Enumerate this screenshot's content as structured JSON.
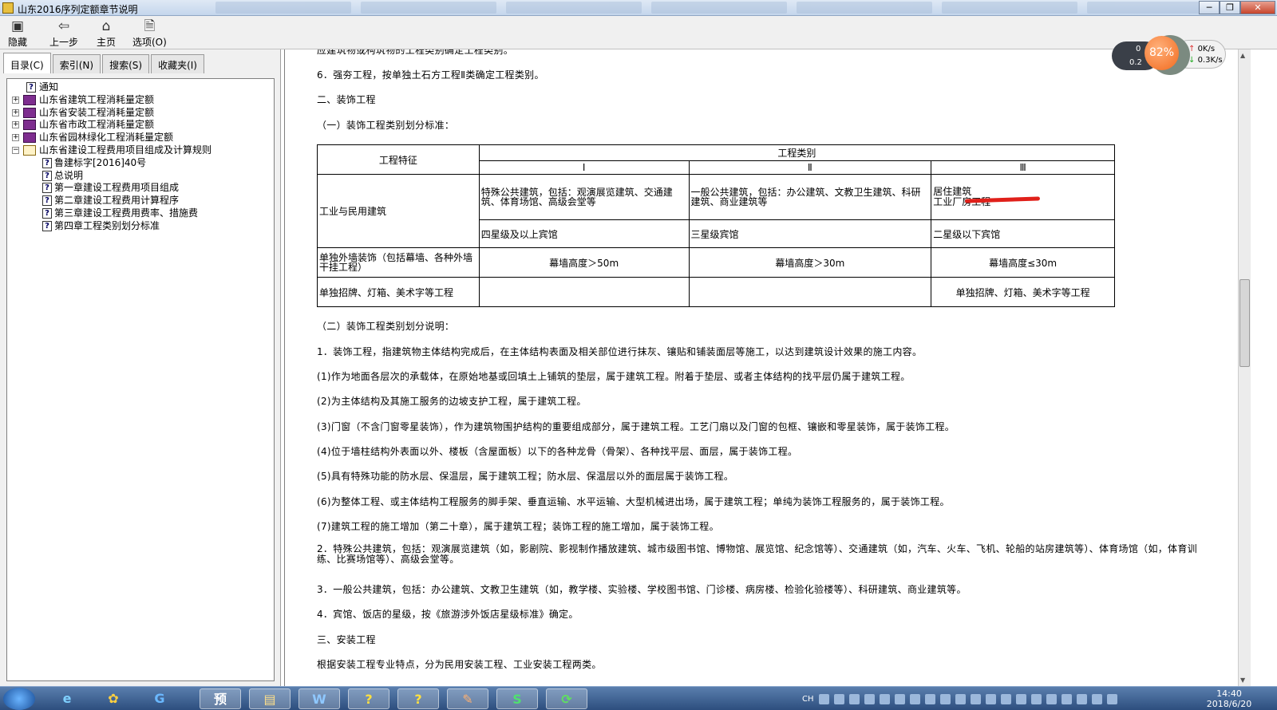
{
  "window": {
    "title": "山东2016序列定额章节说明",
    "buttons": [
      "─",
      "❐",
      "✕"
    ]
  },
  "toolbar": {
    "hide": "隐藏",
    "back": "上一步",
    "home": "主页",
    "options": "选项(O)"
  },
  "tabs": [
    "目录(C)",
    "索引(N)",
    "搜索(S)",
    "收藏夹(I)"
  ],
  "tree": [
    {
      "label": "通知",
      "type": "page",
      "level": 0
    },
    {
      "label": "山东省建筑工程消耗量定额",
      "type": "book",
      "level": 0
    },
    {
      "label": "山东省安装工程消耗量定额",
      "type": "book",
      "level": 0
    },
    {
      "label": "山东省市政工程消耗量定额",
      "type": "book",
      "level": 0
    },
    {
      "label": "山东省园林绿化工程消耗量定额",
      "type": "book",
      "level": 0
    },
    {
      "label": "山东省建设工程费用项目组成及计算规则",
      "type": "book-open",
      "level": 0
    },
    {
      "label": "鲁建标字[2016]40号",
      "type": "page",
      "level": 1
    },
    {
      "label": "总说明",
      "type": "page",
      "level": 1
    },
    {
      "label": "第一章建设工程费用项目组成",
      "type": "page",
      "level": 1
    },
    {
      "label": "第二章建设工程费用计算程序",
      "type": "page",
      "level": 1
    },
    {
      "label": "第三章建设工程费用费率、措施费",
      "type": "page",
      "level": 1
    },
    {
      "label": "第四章工程类别划分标准",
      "type": "page",
      "level": 1
    }
  ],
  "content": {
    "cut_line": "应建筑物或构筑物的工程类别确定工程类别。",
    "p_qianghang": "6．强夯工程，按单独土石方工程Ⅱ类确定工程类别。",
    "h_zhuangshi": "二、装饰工程",
    "h_sub1": "（一）装饰工程类别划分标准：",
    "table": {
      "h_feature": "工程特征",
      "h_category": "工程类别",
      "h_I": "Ⅰ",
      "h_II": "Ⅱ",
      "h_III": "Ⅲ",
      "r1_label": "工业与民用建筑",
      "r1a_I": "特殊公共建筑，包括：观演展览建筑、交通建筑、体育场馆、高级会堂等",
      "r1a_II": "一般公共建筑，包括：办公建筑、文教卫生建筑、科研建筑、商业建筑等",
      "r1a_III_1": "居住建筑",
      "r1a_III_2": "工业厂房工程",
      "r1b_I": "四星级及以上宾馆",
      "r1b_II": "三星级宾馆",
      "r1b_III": "二星级以下宾馆",
      "r2_label": "单独外墙装饰（包括幕墙、各种外墙干挂工程）",
      "r2_I": "幕墙高度＞50m",
      "r2_II": "幕墙高度＞30m",
      "r2_III": "幕墙高度≤30m",
      "r3_label": "单独招牌、灯箱、美术字等工程",
      "r3_III": "单独招牌、灯箱、美术字等工程"
    },
    "h_sub2": "（二）装饰工程类别划分说明：",
    "p1": "1．装饰工程，指建筑物主体结构完成后，在主体结构表面及相关部位进行抹灰、镶贴和铺装面层等施工，以达到建筑设计效果的施工内容。",
    "p1_1": "(1)作为地面各层次的承载体，在原始地基或回填土上铺筑的垫层，属于建筑工程。附着于垫层、或者主体结构的找平层仍属于建筑工程。",
    "p1_2": "(2)为主体结构及其施工服务的边坡支护工程，属于建筑工程。",
    "p1_3": "(3)门窗（不含门窗零星装饰），作为建筑物围护结构的重要组成部分，属于建筑工程。工艺门扇以及门窗的包框、镶嵌和零星装饰，属于装饰工程。",
    "p1_4": "(4)位于墙柱结构外表面以外、楼板（含屋面板）以下的各种龙骨（骨架）、各种找平层、面层，属于装饰工程。",
    "p1_5": "(5)具有特殊功能的防水层、保温层，属于建筑工程；防水层、保温层以外的面层属于装饰工程。",
    "p1_6": "(6)为整体工程、或主体结构工程服务的脚手架、垂直运输、水平运输、大型机械进出场，属于建筑工程；单纯为装饰工程服务的，属于装饰工程。",
    "p1_7": "(7)建筑工程的施工增加（第二十章），属于建筑工程；装饰工程的施工增加，属于装饰工程。",
    "p2": "2．特殊公共建筑，包括：观演展览建筑（如，影剧院、影视制作播放建筑、城市级图书馆、博物馆、展览馆、纪念馆等）、交通建筑（如，汽车、火车、飞机、轮船的站房建筑等）、体育场馆（如，体育训练、比赛场馆等）、高级会堂等。",
    "p3": "3．一般公共建筑，包括：办公建筑、文教卫生建筑（如，教学楼、实验楼、学校图书馆、门诊楼、病房楼、检验化验楼等）、科研建筑、商业建筑等。",
    "p4": "4．宾馆、饭店的星级，按《旅游涉外饭店星级标准》确定。",
    "h_anzhuang": "三、安装工程",
    "p_anzhuang": "根据安装工程专业特点，分为民用安装工程、工业安装工程两类。"
  },
  "widget": {
    "percent": "82%",
    "left_top": "0",
    "left_bottom": "0.2",
    "up_speed": "0K/s",
    "down_speed": "0.3K/s"
  },
  "taskbar": {
    "apps": [
      "e",
      "✿",
      "G",
      "预",
      "▤",
      "W",
      "?",
      "?",
      "✎",
      "S",
      "⟳"
    ],
    "lang": "CH",
    "time": "14:40",
    "date": "2018/6/20"
  },
  "colors": {
    "accent_red": "#e0201a",
    "book_purple": "#7e2d8f",
    "taskbar": "#2d4e7e"
  }
}
